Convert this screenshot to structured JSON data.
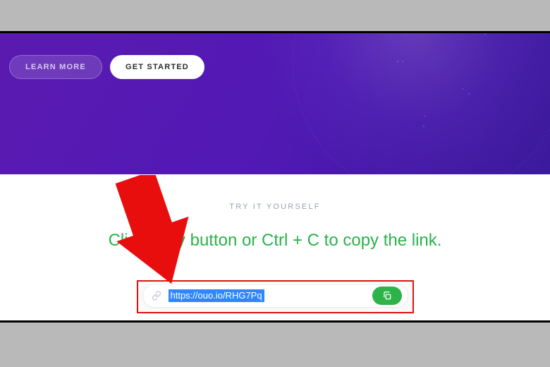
{
  "hero": {
    "learn_more_label": "LEARN MORE",
    "get_started_label": "GET STARTED"
  },
  "section": {
    "eyebrow": "TRY IT YOURSELF",
    "headline": "Click copy button or Ctrl + C to copy the link."
  },
  "linkbar": {
    "url": "https://ouo.io/RHG7Pq"
  }
}
